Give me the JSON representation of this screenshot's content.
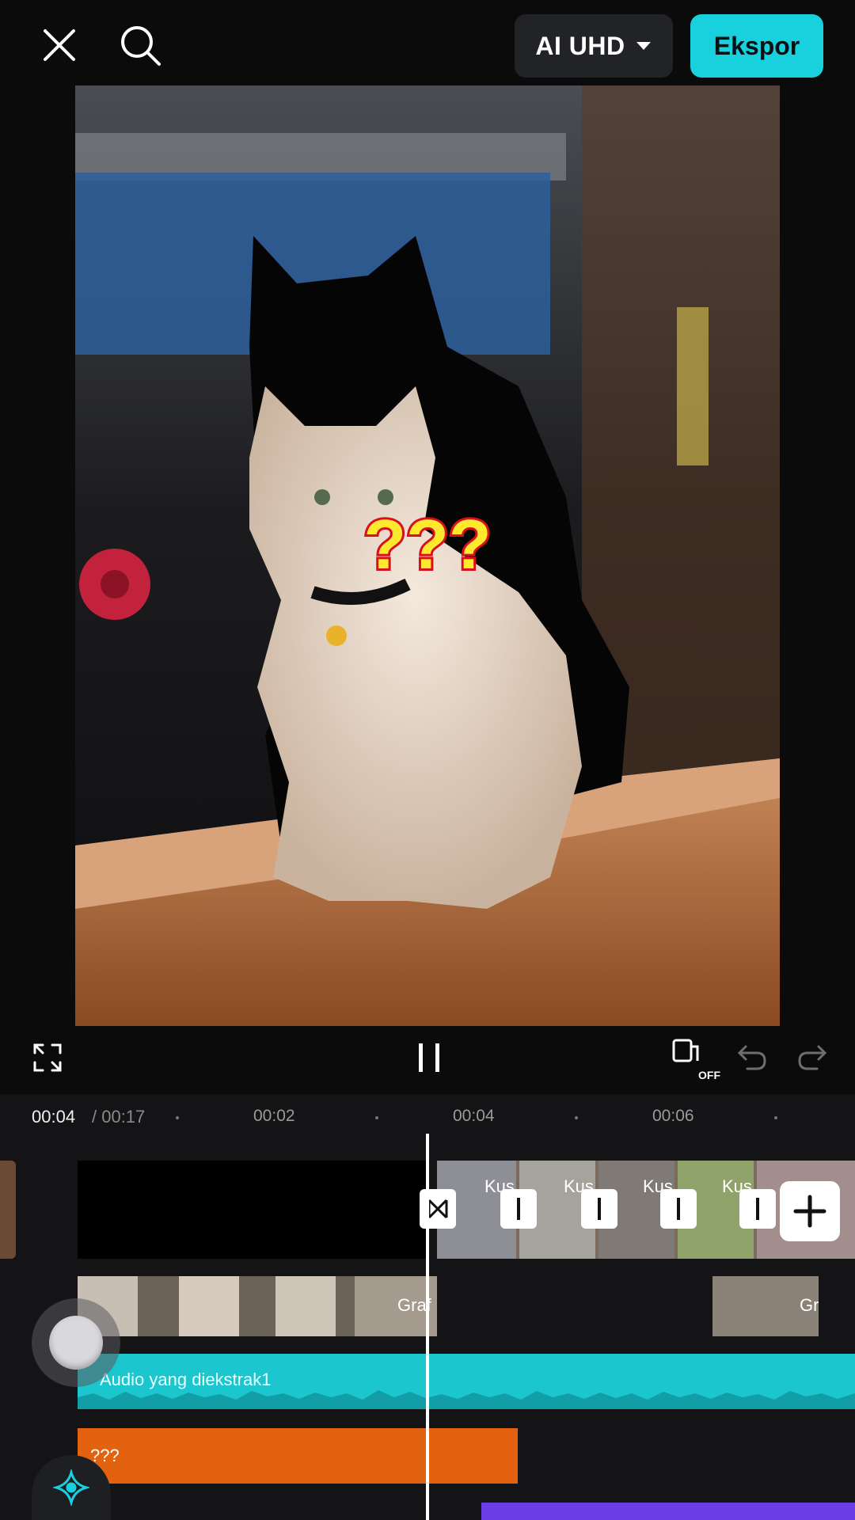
{
  "topbar": {
    "quality_label": "AI UHD",
    "export_label": "Ekspor"
  },
  "preview": {
    "sticker_text": "???"
  },
  "controls": {
    "offline_badge": "OFF"
  },
  "timeline": {
    "current_time": "00:04",
    "total_time": "/ 00:17",
    "ticks": [
      "00:02",
      "00:04",
      "00:06"
    ],
    "main_track": {
      "clip_labels": [
        "Kus",
        "Kus",
        "Kus",
        "Kus"
      ]
    },
    "overlay_track": {
      "labels": [
        "Graf",
        "Gr"
      ]
    },
    "audio_track": {
      "label": "Audio yang diekstrak1",
      "color": "#1cc6cf"
    },
    "text_track": {
      "label": "???",
      "color": "#e2620f"
    }
  },
  "colors": {
    "accent": "#19d0dd",
    "background": "#0b0b0c",
    "music_bar": "#6a3ee6"
  }
}
